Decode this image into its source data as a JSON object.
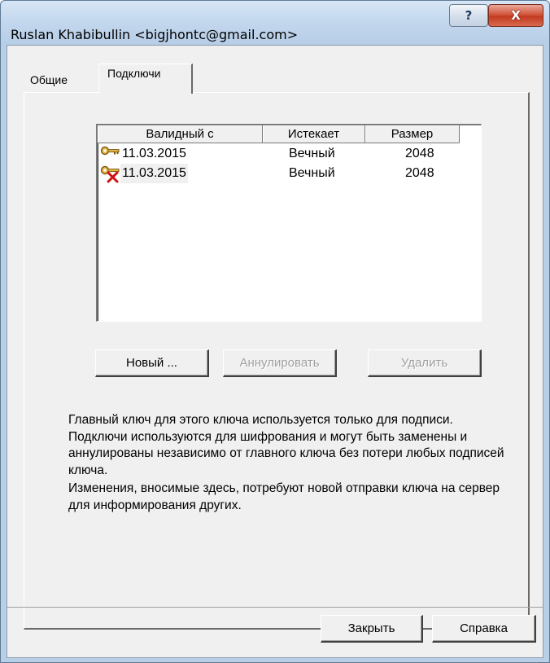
{
  "window": {
    "title": "Ruslan Khabibullin <bigjhontc@gmail.com>",
    "help_glyph": "?",
    "close_glyph": "X"
  },
  "tabs": [
    {
      "label": "Общие",
      "active": false
    },
    {
      "label": "Подключи",
      "active": true
    }
  ],
  "subkeys_table": {
    "columns": [
      "Валидный с",
      "Истекает",
      "Размер"
    ],
    "rows": [
      {
        "icon": "key-icon",
        "valid_from": "11.03.2015",
        "expires": "Вечный",
        "size": "2048"
      },
      {
        "icon": "revoked-key-icon",
        "valid_from": "11.03.2015",
        "expires": "Вечный",
        "size": "2048"
      }
    ]
  },
  "actions": {
    "new_label": "Новый ...",
    "revoke_label": "Аннулировать",
    "delete_label": "Удалить"
  },
  "description": {
    "paragraph_1": "Главный ключ для этого ключа используется только для подписи. Подключи используются для шифрования и могут быть заменены и аннулированы независимо от главного ключа без потери любых подписей ключа.",
    "paragraph_2": "Изменения, вносимые здесь, потребуют новой отправки ключа на сервер для информирования других."
  },
  "footer": {
    "close_label": "Закрыть",
    "help_label": "Справка"
  }
}
